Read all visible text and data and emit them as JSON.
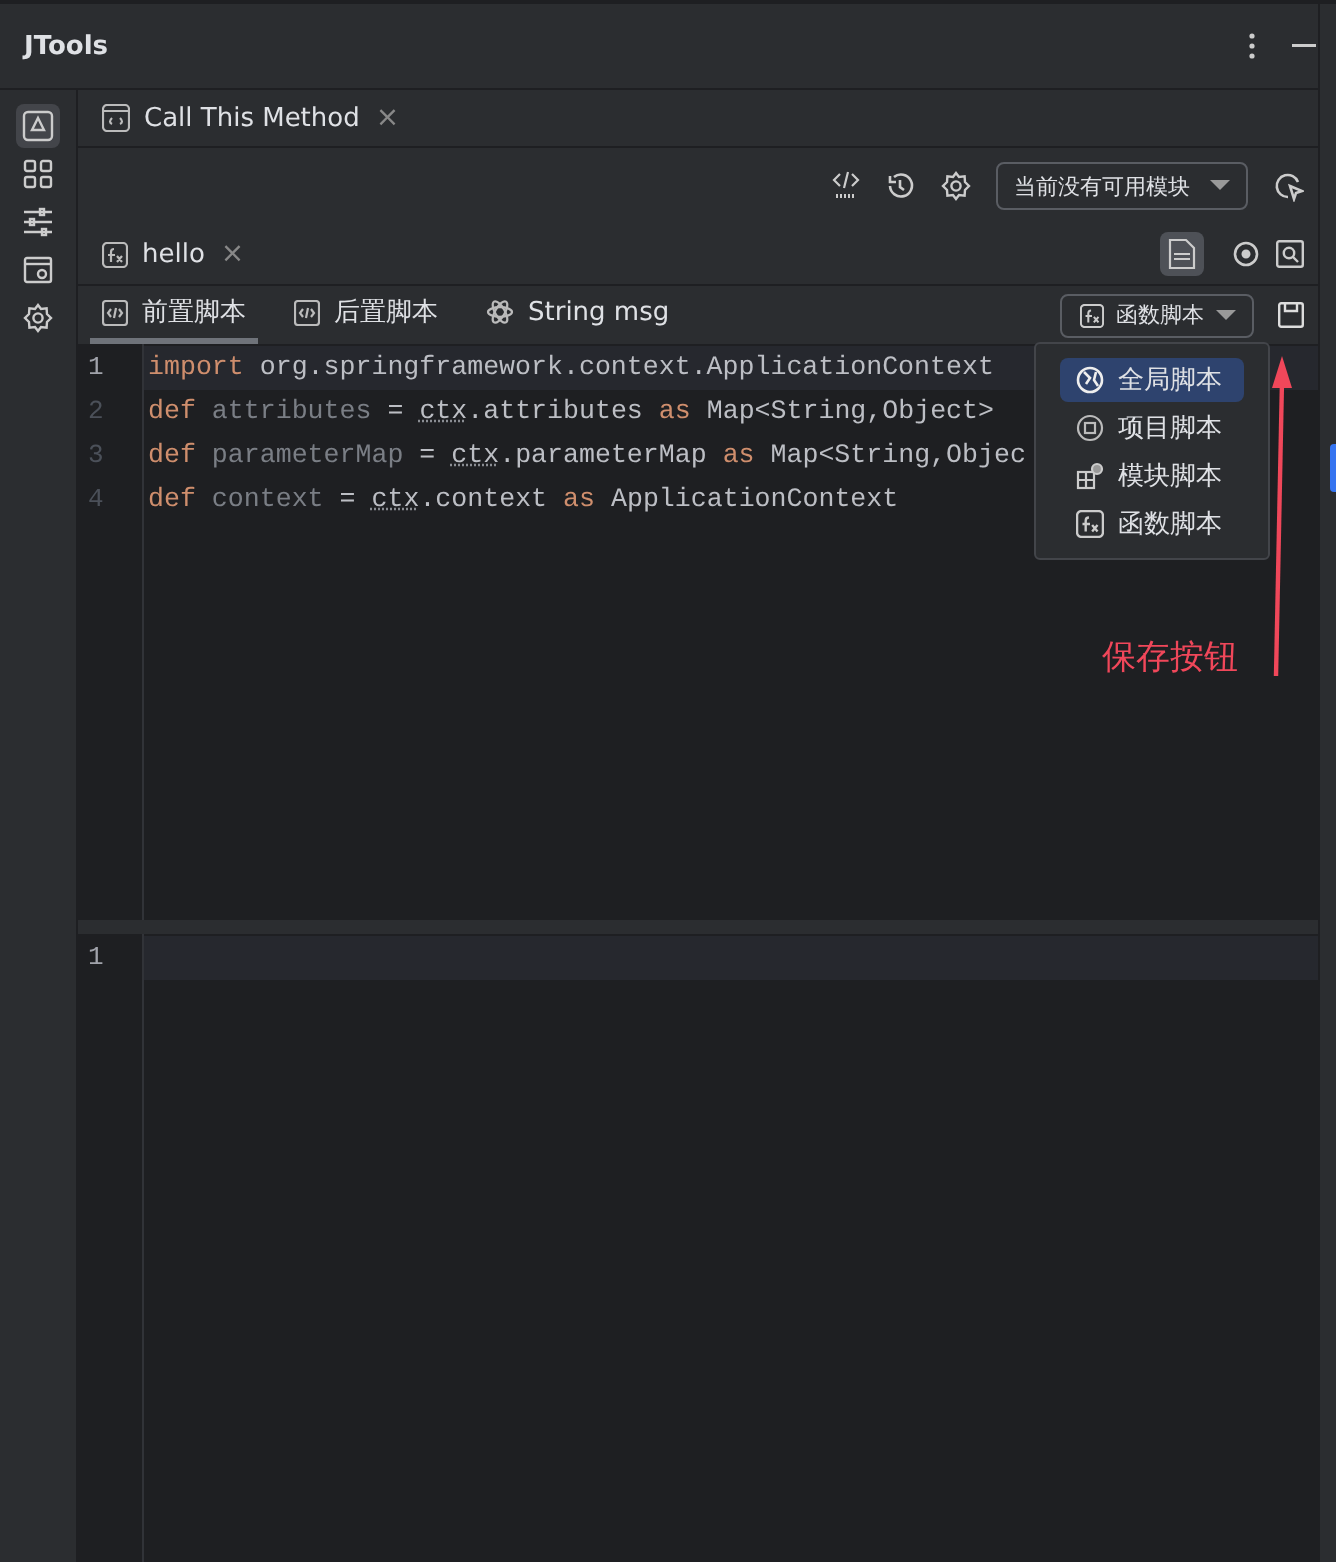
{
  "panel": {
    "title": "JTools"
  },
  "sidebar": {
    "items": [
      {
        "selected": true
      },
      {
        "selected": false
      },
      {
        "selected": false
      },
      {
        "selected": false
      },
      {
        "selected": false
      }
    ]
  },
  "method_tab": {
    "label": "Call This Method",
    "close": "×"
  },
  "toolbar": {
    "module_select": "当前没有可用模块"
  },
  "script_tab": {
    "label": "hello",
    "close": "×"
  },
  "sub_tabs": [
    {
      "label": "前置脚本",
      "selected": true
    },
    {
      "label": "后置脚本",
      "selected": false
    },
    {
      "label": "String msg",
      "selected": false
    }
  ],
  "script_type_select": "函数脚本",
  "editor": {
    "lines": [
      {
        "number": "1",
        "current": true,
        "tokens": [
          {
            "text": "import",
            "kind": "keyword"
          },
          {
            "text": " org.springframework.context.ApplicationContext",
            "kind": "plain"
          }
        ]
      },
      {
        "number": "2",
        "current": false,
        "tokens": [
          {
            "text": "def",
            "kind": "keyword"
          },
          {
            "text": " attributes",
            "kind": "unused"
          },
          {
            "text": " = ",
            "kind": "plain"
          },
          {
            "text": "ctx",
            "kind": "underlined"
          },
          {
            "text": ".attributes ",
            "kind": "plain"
          },
          {
            "text": "as",
            "kind": "keyword"
          },
          {
            "text": " Map<String,Object>",
            "kind": "plain"
          }
        ]
      },
      {
        "number": "3",
        "current": false,
        "tokens": [
          {
            "text": "def",
            "kind": "keyword"
          },
          {
            "text": " parameterMap",
            "kind": "unused"
          },
          {
            "text": " = ",
            "kind": "plain"
          },
          {
            "text": "ctx",
            "kind": "underlined"
          },
          {
            "text": ".parameterMap ",
            "kind": "plain"
          },
          {
            "text": "as",
            "kind": "keyword"
          },
          {
            "text": " Map<String,Objec",
            "kind": "plain"
          }
        ]
      },
      {
        "number": "4",
        "current": false,
        "tokens": [
          {
            "text": "def",
            "kind": "keyword"
          },
          {
            "text": " context",
            "kind": "unused"
          },
          {
            "text": " = ",
            "kind": "plain"
          },
          {
            "text": "ctx",
            "kind": "underlined"
          },
          {
            "text": ".context ",
            "kind": "plain"
          },
          {
            "text": "as",
            "kind": "keyword"
          },
          {
            "text": " ApplicationContext",
            "kind": "plain"
          }
        ]
      }
    ]
  },
  "dropdown_menu": [
    {
      "label": "全局脚本",
      "selected": true
    },
    {
      "label": "项目脚本",
      "selected": false
    },
    {
      "label": "模块脚本",
      "selected": false
    },
    {
      "label": "函数脚本",
      "selected": false
    }
  ],
  "annotation": {
    "text": "保存按钮"
  },
  "output_editor": {
    "lines": [
      {
        "number": "1",
        "current": true
      }
    ]
  }
}
